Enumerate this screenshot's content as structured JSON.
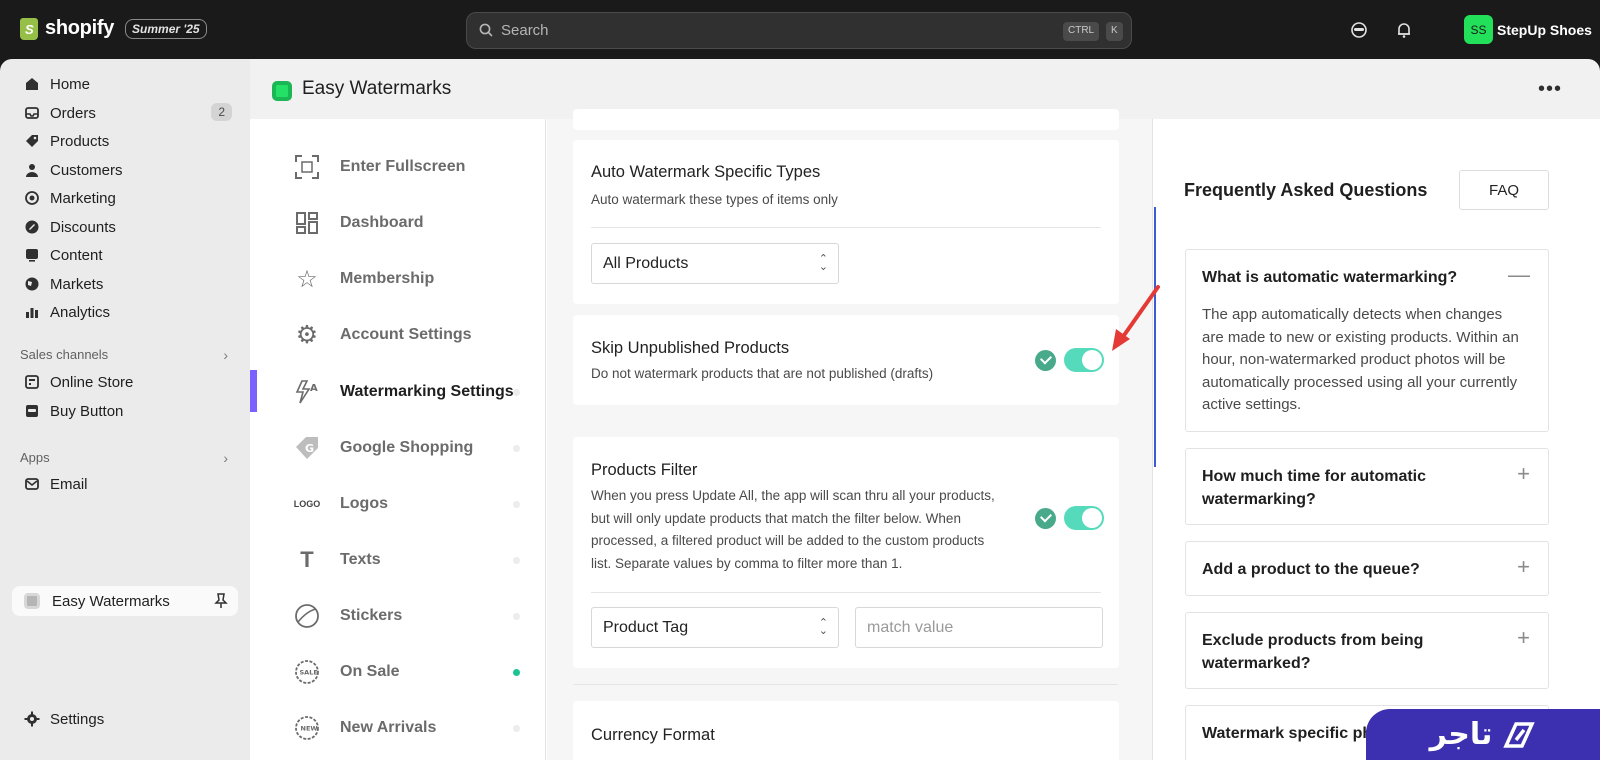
{
  "topbar": {
    "brand": "shopify",
    "edition": "Summer '25",
    "search_placeholder": "Search",
    "shortcut_ctrl": "CTRL",
    "shortcut_k": "K",
    "store_initials": "SS",
    "store_name": "StepUp Shoes"
  },
  "sidebar": {
    "items": [
      {
        "label": "Home",
        "icon": "home-icon"
      },
      {
        "label": "Orders",
        "icon": "inbox-icon",
        "badge": "2"
      },
      {
        "label": "Products",
        "icon": "tag-icon"
      },
      {
        "label": "Customers",
        "icon": "person-icon"
      },
      {
        "label": "Marketing",
        "icon": "target-icon"
      },
      {
        "label": "Discounts",
        "icon": "discount-icon"
      },
      {
        "label": "Content",
        "icon": "image-icon"
      },
      {
        "label": "Markets",
        "icon": "globe-icon"
      },
      {
        "label": "Analytics",
        "icon": "bar-chart-icon"
      }
    ],
    "sales_channels_label": "Sales channels",
    "sales_channels": [
      {
        "label": "Online Store",
        "icon": "store-icon"
      },
      {
        "label": "Buy Button",
        "icon": "buy-button-icon"
      }
    ],
    "apps_label": "Apps",
    "apps": [
      {
        "label": "Email",
        "icon": "mail-icon"
      }
    ],
    "active_app": "Easy Watermarks",
    "settings_label": "Settings"
  },
  "app": {
    "title": "Easy Watermarks",
    "more": "•••"
  },
  "subnav": {
    "items": [
      {
        "label": "Enter Fullscreen",
        "icon": "fullscreen-icon"
      },
      {
        "label": "Dashboard",
        "icon": "dashboard-icon"
      },
      {
        "label": "Membership",
        "icon": "star-icon"
      },
      {
        "label": "Account Settings",
        "icon": "gear-icon"
      },
      {
        "label": "Watermarking Settings",
        "icon": "watermark-settings-icon",
        "active": true
      },
      {
        "label": "Google Shopping",
        "icon": "google-tag-icon"
      },
      {
        "label": "Logos",
        "icon": "logo-icon",
        "icon_text": "LOGO"
      },
      {
        "label": "Texts",
        "icon": "text-icon",
        "icon_text": "T"
      },
      {
        "label": "Stickers",
        "icon": "sticker-icon"
      },
      {
        "label": "On Sale",
        "icon": "sale-badge-icon",
        "icon_text": "SALE",
        "status_on": true
      },
      {
        "label": "New Arrivals",
        "icon": "new-badge-icon",
        "icon_text": "NEW"
      }
    ]
  },
  "settings": {
    "auto_watermark": {
      "title": "Auto Watermark Specific Types",
      "subtitle": "Auto watermark these types of items only",
      "selected": "All Products"
    },
    "skip_unpublished": {
      "title": "Skip Unpublished Products",
      "subtitle": "Do not watermark products that are not published (drafts)",
      "enabled": true
    },
    "products_filter": {
      "title": "Products Filter",
      "description_lines": [
        "When you press Update All, the app will scan thru all your products,",
        "but will only update products that match the filter below. When",
        "processed, a filtered product will be added to the custom products",
        "list. Separate values by comma to filter more than 1."
      ],
      "enabled": true,
      "filter_field": "Product Tag",
      "match_placeholder": "match value"
    },
    "currency_format": {
      "title": "Currency Format"
    }
  },
  "faq": {
    "title": "Frequently Asked Questions",
    "button": "FAQ",
    "items": [
      {
        "question": "What is automatic watermarking?",
        "expanded": true,
        "answer_lines": [
          "The app automatically detects when changes",
          "are made to new or existing products. Within an",
          "hour, non-watermarked product photos will be",
          "automatically processed using all your currently",
          "active settings."
        ]
      },
      {
        "question_lines": [
          "How much time for automatic",
          "watermarking?"
        ]
      },
      {
        "question": "Add a product to the queue?"
      },
      {
        "question_lines": [
          "Exclude products from being",
          "watermarked?"
        ]
      },
      {
        "question": "Watermark specific ph"
      }
    ]
  },
  "brand_watermark": "تاجر",
  "colors": {
    "accent": "#7b61ff",
    "toggle_on": "#55dbbb",
    "check": "#49a98b",
    "arrow": "#e53935",
    "brand_bg": "#3c2fb0",
    "store_avatar": "#23e05b"
  }
}
